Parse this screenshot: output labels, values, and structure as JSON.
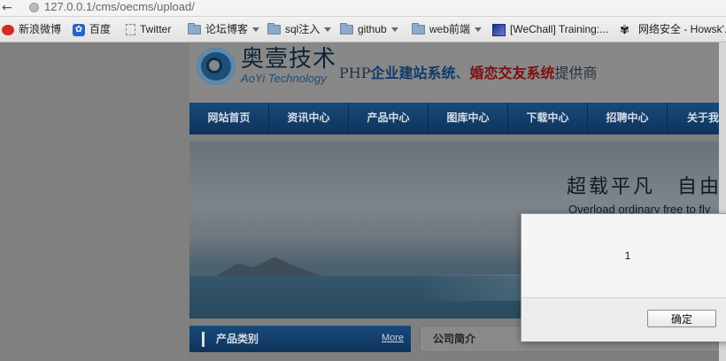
{
  "address_bar": {
    "url": "127.0.0.1/cms/oecms/upload/"
  },
  "bookmarks": [
    {
      "label": "新浪微博",
      "icon": "weibo-icon"
    },
    {
      "label": "百度",
      "icon": "baidu-paw-icon"
    },
    {
      "label": "Twitter",
      "icon": "page-icon"
    },
    {
      "label": "论坛博客",
      "icon": "folder-icon"
    },
    {
      "label": "sql注入",
      "icon": "folder-icon"
    },
    {
      "label": "github",
      "icon": "folder-icon"
    },
    {
      "label": "web前端",
      "icon": "folder-icon"
    },
    {
      "label": "[WeChall] Training:...",
      "icon": "wechall-icon"
    },
    {
      "label": "网络安全 - Howsk'...",
      "icon": "howsk-icon"
    }
  ],
  "site": {
    "logo_cn": "奥壹技术",
    "logo_en": "AoYi Technology",
    "slogan_prefix": "PHP",
    "slogan_part1": "企业建站系统",
    "slogan_sep": "、",
    "slogan_part2": "婚恋交友系统",
    "slogan_suffix": "提供商"
  },
  "nav": [
    "网站首页",
    "资讯中心",
    "产品中心",
    "图库中心",
    "下载中心",
    "招聘中心",
    "关于我们"
  ],
  "banner": {
    "title": "超载平凡　自由",
    "subtitle": "Overload ordinary free to fly"
  },
  "category": {
    "title": "产品类别",
    "more": "More"
  },
  "intro": {
    "title": "公司简介"
  },
  "dialog": {
    "message": "1",
    "ok_label": "确定"
  }
}
